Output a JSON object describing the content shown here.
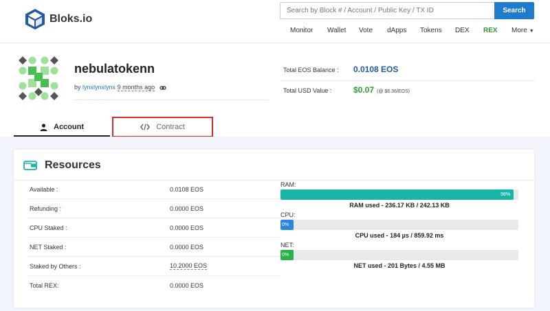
{
  "brand": {
    "name": "Bloks.io",
    "color": "#1f5aa6"
  },
  "search": {
    "placeholder": "Search by Block # / Account / Public Key / TX ID",
    "button_label": "Search"
  },
  "nav": {
    "items": [
      "Monitor",
      "Wallet",
      "Vote",
      "dApps",
      "Tokens",
      "DEX",
      "REX",
      "More"
    ],
    "rex_color": "#2e9e2e"
  },
  "account": {
    "name": "nebulatokenn",
    "by_prefix": "by",
    "creator": "lynxlynxlynx",
    "age": "9 months ago"
  },
  "balance": {
    "eos_label": "Total EOS Balance :",
    "eos_value": "0.0108 EOS",
    "usd_label": "Total USD Value :",
    "usd_value": "$0.07",
    "usd_rate": "(@ $6.36/EOS)"
  },
  "tabs": {
    "account_label": "Account",
    "contract_label": "Contract"
  },
  "resources": {
    "title": "Resources",
    "rows": [
      {
        "label": "Available :",
        "value": "0.0108 EOS"
      },
      {
        "label": "Refunding :",
        "value": "0.0000 EOS"
      },
      {
        "label": "CPU Staked :",
        "value": "0.0000 EOS"
      },
      {
        "label": "NET Staked :",
        "value": "0.0000 EOS"
      },
      {
        "label": "Staked by Others :",
        "value": "10.2000 EOS"
      },
      {
        "label": "Total REX:",
        "value": "0.0000 EOS"
      }
    ],
    "ram": {
      "label": "RAM:",
      "percent_text": "98%",
      "percent": 98,
      "caption": "RAM used - 236.17 KB / 242.13 KB",
      "color": "#17b5a6"
    },
    "cpu": {
      "label": "CPU:",
      "percent_text": "0%",
      "percent": 0,
      "caption": "CPU used - 184 µs / 859.92 ms",
      "color": "#2b88d8"
    },
    "net": {
      "label": "NET:",
      "percent_text": "0%",
      "percent": 0,
      "caption": "NET used - 201 Bytes / 4.55 MB",
      "color": "#2ab24a"
    }
  }
}
